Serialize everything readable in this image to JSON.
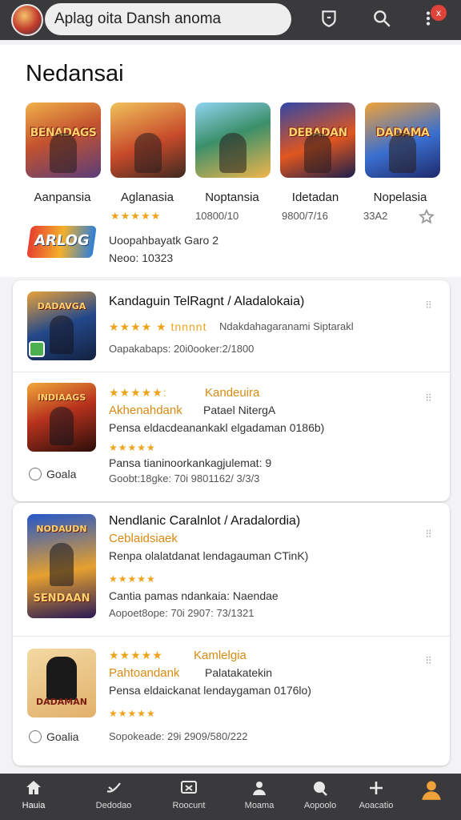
{
  "topbar": {
    "search_text": "Aplag oita Dansh anoma",
    "notification_count": "x"
  },
  "hero": {
    "title": "Nedansai",
    "tiles": [
      {
        "label": "BENADAGS",
        "name": "Aanpansia",
        "stars": "★★★★★"
      },
      {
        "label": "",
        "name": "Aglanasia",
        "meta": "10800/10"
      },
      {
        "label": "",
        "name": "Noptansia",
        "meta": "9800/7/16"
      },
      {
        "label": "DEBADAN",
        "name": "Idetadan",
        "meta": "33A2"
      },
      {
        "label": "DADAMA",
        "name": "Nopelasia"
      }
    ],
    "promo_logo": "ARLOG",
    "promo_line1": "Uoopahbayatk  Garo 2",
    "promo_line2": "Neoo: 10323"
  },
  "card1": {
    "items": [
      {
        "thumb_label": "DADAVGA",
        "title": "Kandaguin TelRagnt / Aladalokaia)",
        "stars": "★★★★ ★ tnnnnt",
        "subtitle": "Ndakdahagaranami Siptarakl",
        "meta": "Oapakabaps:  20i0ooker:2/1800"
      },
      {
        "thumb_label": "INDIAAGS",
        "title_stars": "★★★★★:",
        "title_orange": "Kandeuira",
        "sub_orange": "Akhenahdank",
        "sub_right": "Patael NitergA",
        "desc": "Pensa  eldacdeanankakl  elgadaman  0186b)",
        "stars": "★★★★★",
        "line": "Pansa  tianinoorkankagjulemat: 9",
        "meta": "Goobt:18gke:  70i 9801162/ 3/3/3",
        "chip": "Goala"
      }
    ]
  },
  "card2": {
    "items": [
      {
        "thumb_label": "NODAUDN",
        "thumb_label2": "SENDAAN",
        "title": "Nendlanic Caralnlot / Aradalordia)",
        "orange": "Ceblaidsiaek",
        "desc": "Renpa  olalatdanat  lendagauman  CTinK)",
        "stars": "★★★★★",
        "line": "Cantia  pamas  ndankaia:  Naendae",
        "meta": "Aopoet8ope:  70i 2907: 73/1321"
      },
      {
        "thumb_label": "DADAMAN",
        "title_stars": "★★★★★",
        "title_orange": "Kamlelgia",
        "sub_orange": "Pahtoandank",
        "sub_right": "Palatakatekin",
        "desc": "Pensa  eldaickanat  lendaygaman  0176lo)",
        "stars": "★★★★★",
        "meta": "Sopokeade:  29i 2909/580/222",
        "chip": "Goalia"
      }
    ]
  },
  "bottomnav": [
    {
      "label": "Hauia"
    },
    {
      "label": "Dedodao"
    },
    {
      "label": "Roocunt"
    },
    {
      "label": "Moama"
    },
    {
      "label": "Aopoolo"
    },
    {
      "label": "Aoacatio"
    },
    {
      "label": ""
    }
  ]
}
